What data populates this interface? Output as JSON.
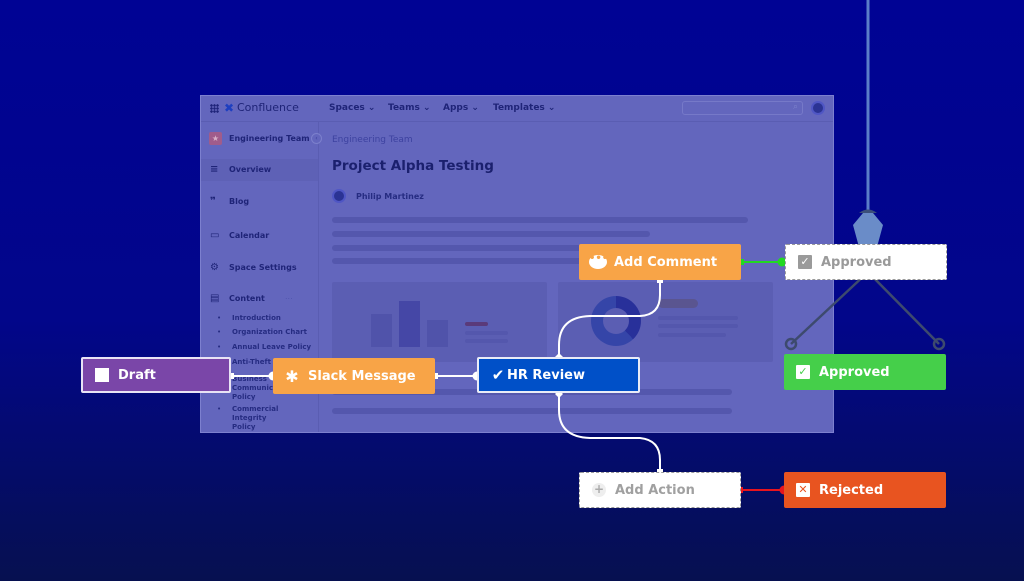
{
  "app": {
    "name": "Confluence",
    "nav": [
      "Spaces ⌄",
      "Teams ⌄",
      "Apps ⌄",
      "Templates ⌄"
    ],
    "search_placeholder": "",
    "search_icon": "search-icon",
    "avatar_icon": "user-avatar-icon"
  },
  "sidebar": {
    "team_name": "Engineering Team",
    "team_icon": "star-icon",
    "collapse_icon": "chevron-left-icon",
    "items": [
      {
        "label": "Overview",
        "icon": "≡",
        "active": true
      },
      {
        "label": "Blog",
        "icon": "❞",
        "active": false
      },
      {
        "label": "Calendar",
        "icon": "▭",
        "active": false
      },
      {
        "label": "Space Settings",
        "icon": "⚙",
        "active": false
      },
      {
        "label": "Content",
        "icon": "▤",
        "active": false
      }
    ],
    "content_more": "...",
    "content_children": [
      "Introduction",
      "Organization Chart",
      "Annual Leave Policy",
      "Anti-Theft Policy",
      "Business Communication Policy",
      "Commercial Integrity Policy"
    ]
  },
  "page": {
    "breadcrumb": "Engineering Team",
    "title": "Project Alpha Testing",
    "author": "Philip Martinez"
  },
  "workflow": {
    "nodes": {
      "draft": {
        "label": "Draft",
        "color": "#7a46a8"
      },
      "slack": {
        "label": "Slack Message",
        "color": "#f8a447"
      },
      "hr_review": {
        "label": "HR Review",
        "color": "#0050c8"
      },
      "add_comment": {
        "label": "Add Comment",
        "color": "#f8a447"
      },
      "approved_ghost": {
        "label": "Approved",
        "color": "#ffffff"
      },
      "approved": {
        "label": "Approved",
        "color": "#45cf4a"
      },
      "add_action": {
        "label": "Add Action",
        "color": "#ffffff"
      },
      "rejected": {
        "label": "Rejected",
        "color": "#e85420"
      }
    },
    "icons": {
      "check": "✔",
      "check_box": "✓",
      "x_box": "✕",
      "plus": "+",
      "comment": "•••",
      "slack": "slack-icon"
    },
    "connector_colors": {
      "approve": "#22d822",
      "reject": "#e8141e",
      "default": "#ffffff"
    }
  },
  "background": {
    "top": "#000394",
    "bottom": "#061050"
  }
}
